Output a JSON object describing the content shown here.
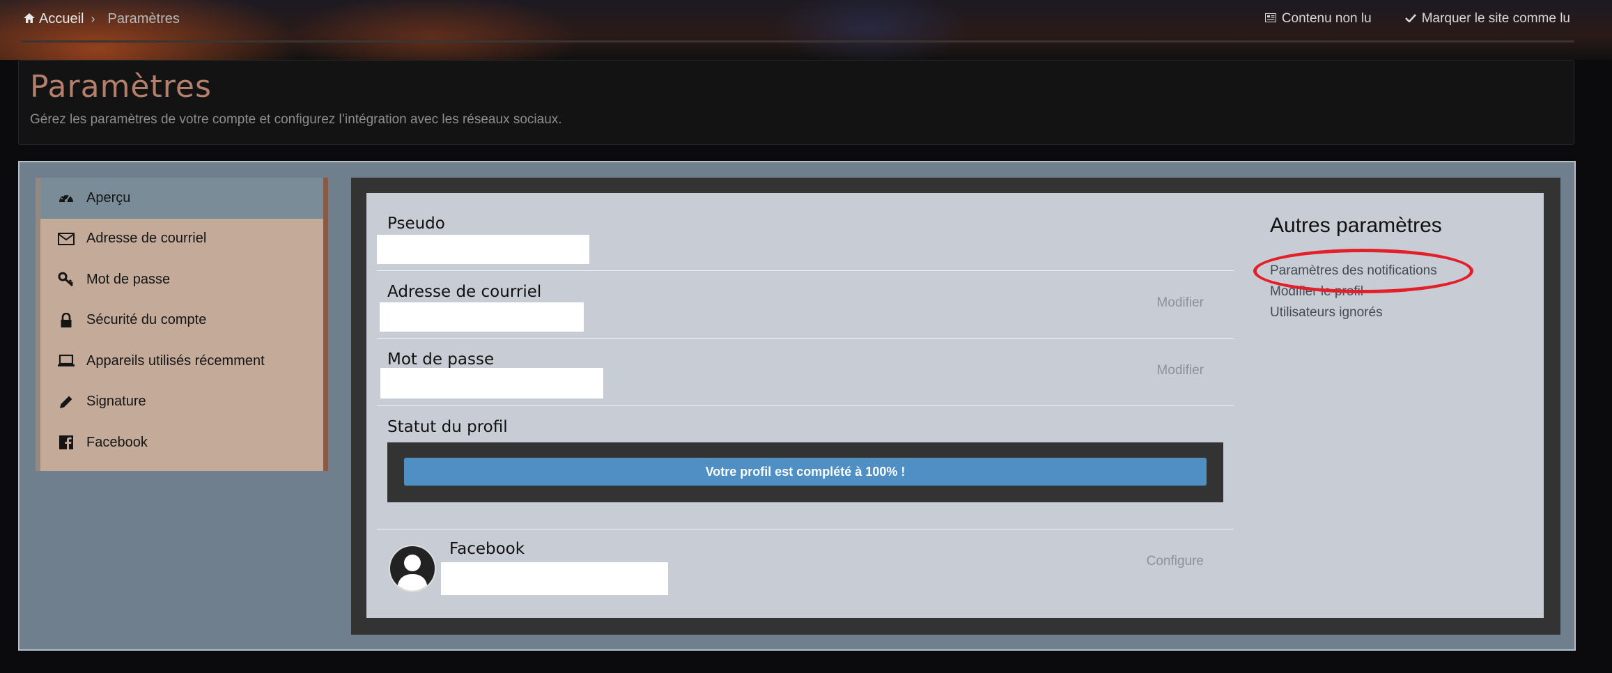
{
  "breadcrumb": {
    "home": "Accueil",
    "current": "Paramètres"
  },
  "topnav": {
    "unread": "Contenu non lu",
    "mark_read": "Marquer le site comme lu"
  },
  "header": {
    "title": "Paramètres",
    "subtitle": "Gérez les paramètres de votre compte et configurez l’intégration avec les réseaux sociaux."
  },
  "sidebar": {
    "items": [
      {
        "label": "Aperçu",
        "icon": "dashboard-icon"
      },
      {
        "label": "Adresse de courriel",
        "icon": "envelope-icon"
      },
      {
        "label": "Mot de passe",
        "icon": "key-icon"
      },
      {
        "label": "Sécurité du compte",
        "icon": "lock-icon"
      },
      {
        "label": "Appareils utilisés récemment",
        "icon": "laptop-icon"
      },
      {
        "label": "Signature",
        "icon": "pencil-icon"
      },
      {
        "label": "Facebook",
        "icon": "facebook-icon"
      }
    ]
  },
  "overview": {
    "pseudo_label": "Pseudo",
    "email_label": "Adresse de courriel",
    "email_action": "Modifier",
    "password_label": "Mot de passe",
    "password_action": "Modifier",
    "status_label": "Statut du profil",
    "progress_text": "Votre profil est complété à 100% !",
    "progress_percent": 100,
    "facebook_label": "Facebook",
    "facebook_action": "Configure"
  },
  "other_settings": {
    "title": "Autres paramètres",
    "links": [
      "Paramètres des notifications",
      "Modifier le profil",
      "Utilisateurs ignorés"
    ]
  },
  "colors": {
    "accent": "#4f8fc4",
    "title": "#b4806c",
    "highlight": "#e3202a"
  }
}
